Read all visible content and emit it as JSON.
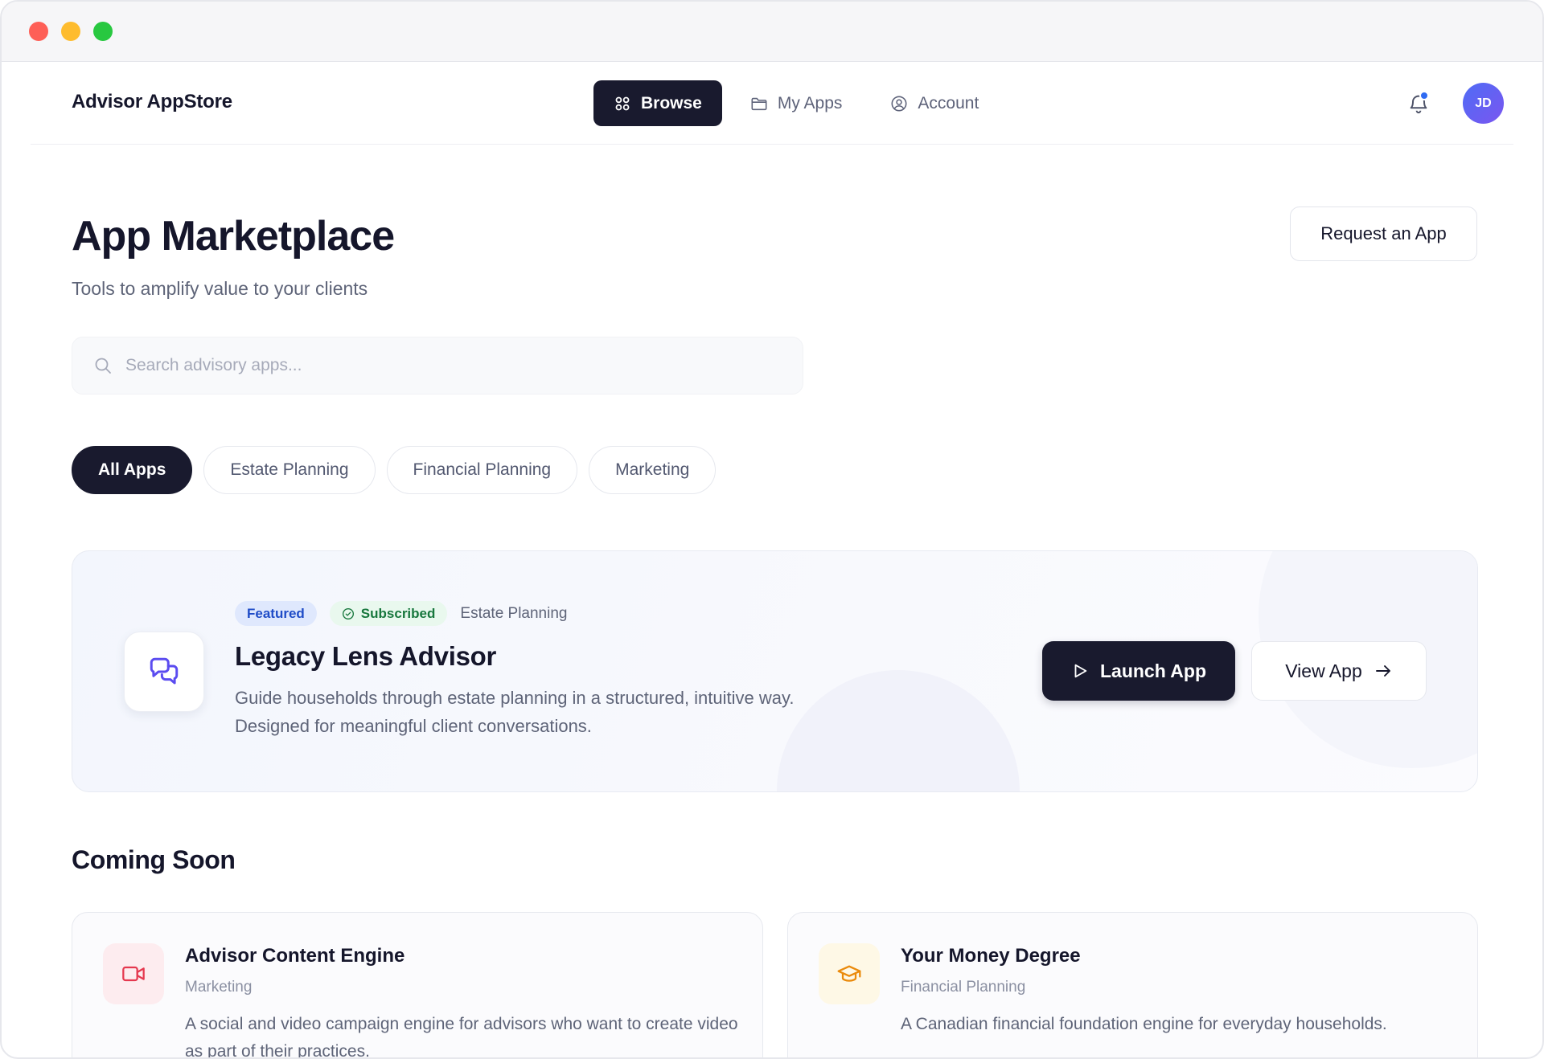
{
  "brand": {
    "name": "Advisor AppStore"
  },
  "nav": {
    "browse": "Browse",
    "my_apps": "My Apps",
    "account": "Account"
  },
  "user": {
    "initials": "JD",
    "has_notifications": true
  },
  "page": {
    "title": "App Marketplace",
    "subtitle": "Tools to amplify value to your clients",
    "request_button": "Request an App"
  },
  "search": {
    "placeholder": "Search advisory apps..."
  },
  "filters": [
    "All Apps",
    "Estate Planning",
    "Financial Planning",
    "Marketing"
  ],
  "active_filter": "All Apps",
  "featured": {
    "tag_featured": "Featured",
    "tag_subscribed": "Subscribed",
    "category": "Estate Planning",
    "title": "Legacy Lens Advisor",
    "description_line1": "Guide households through estate planning in a structured, intuitive way.",
    "description_line2": "Designed for meaningful client conversations.",
    "launch_label": "Launch App",
    "view_label": "View App"
  },
  "coming_soon": {
    "title": "Coming Soon",
    "apps": [
      {
        "title": "Advisor Content Engine",
        "category": "Marketing",
        "description": "A social and video campaign engine for advisors who want to create video as part of their practices.",
        "icon": "video-icon",
        "icon_color": "#e5384f"
      },
      {
        "title": "Your Money Degree",
        "category": "Financial Planning",
        "description": "A Canadian financial foundation engine for everyday households.",
        "icon": "graduation-cap-icon",
        "icon_color": "#ea8a0b"
      }
    ]
  },
  "colors": {
    "primary_dark": "#191a2e",
    "accent_blue": "#2f6bf2",
    "featured_purple": "#5b4cf0"
  }
}
